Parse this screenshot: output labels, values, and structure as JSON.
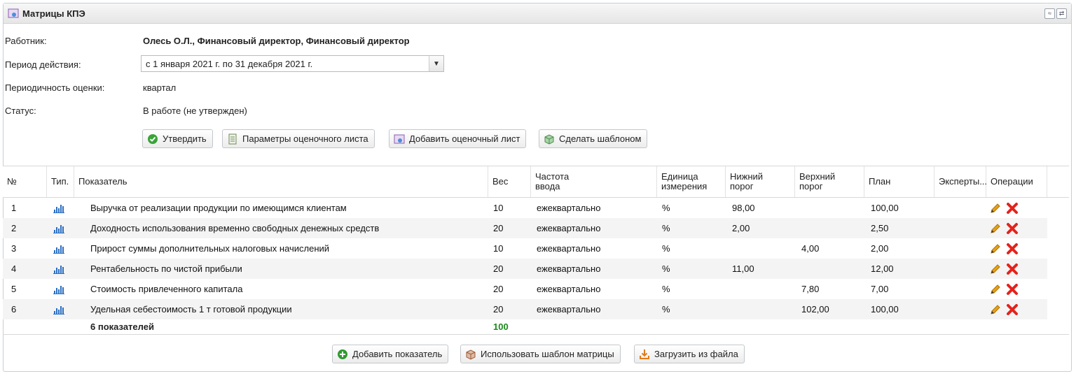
{
  "panel": {
    "title": "Матрицы КПЭ",
    "tool_collapse": "≈",
    "tool_refresh": "⇄"
  },
  "form": {
    "employee_label": "Работник:",
    "employee_value": "Олесь О.Л., Финансовый директор, Финансовый директор",
    "period_label": "Период действия:",
    "period_value": "с 1 января 2021 г. по 31 декабря 2021 г.",
    "frequency_label": "Периодичность оценки:",
    "frequency_value": "квартал",
    "status_label": "Статус:",
    "status_value": "В работе (не утвержден)"
  },
  "actions": {
    "approve": "Утвердить",
    "sheet_params": "Параметры оценочного листа",
    "add_sheet": "Добавить оценочный лист",
    "make_template": "Сделать шаблоном"
  },
  "table": {
    "headers": {
      "num": "№",
      "type": "Тип.",
      "indicator": "Показатель",
      "weight": "Вес",
      "freq1": "Частота",
      "freq2": "ввода",
      "unit1": "Единица",
      "unit2": "измерения",
      "low1": "Нижний",
      "low2": "порог",
      "high1": "Верхний",
      "high2": "порог",
      "plan": "План",
      "experts": "Эксперты...",
      "ops": "Операции"
    },
    "rows": [
      {
        "num": "1",
        "name": "Выручка от реализации продукции по имеющимся клиентам",
        "weight": "10",
        "freq": "ежеквартально",
        "unit": "%",
        "low": "98,00",
        "high": "",
        "plan": "100,00"
      },
      {
        "num": "2",
        "name": "Доходность использования временно свободных денежных средств",
        "weight": "20",
        "freq": "ежеквартально",
        "unit": "%",
        "low": "2,00",
        "high": "",
        "plan": "2,50"
      },
      {
        "num": "3",
        "name": "Прирост суммы дополнительных налоговых начислений",
        "weight": "10",
        "freq": "ежеквартально",
        "unit": "%",
        "low": "",
        "high": "4,00",
        "plan": "2,00"
      },
      {
        "num": "4",
        "name": "Рентабельность по чистой прибыли",
        "weight": "20",
        "freq": "ежеквартально",
        "unit": "%",
        "low": "11,00",
        "high": "",
        "plan": "12,00"
      },
      {
        "num": "5",
        "name": "Стоимость привлеченного капитала",
        "weight": "20",
        "freq": "ежеквартально",
        "unit": "%",
        "low": "",
        "high": "7,80",
        "plan": "7,00"
      },
      {
        "num": "6",
        "name": "Удельная себестоимость 1 т готовой продукции",
        "weight": "20",
        "freq": "ежеквартально",
        "unit": "%",
        "low": "",
        "high": "102,00",
        "plan": "100,00"
      }
    ],
    "summary_label": "6 показателей",
    "summary_weight": "100"
  },
  "footer": {
    "add_indicator": "Добавить показатель",
    "use_template": "Использовать шаблон матрицы",
    "load_file": "Загрузить из файла"
  },
  "colors": {
    "accent_blue": "#2b6fc2",
    "delete_red": "#e3231c",
    "edit_orange": "#d98a0b",
    "summary_green": "#1a8a1a"
  }
}
